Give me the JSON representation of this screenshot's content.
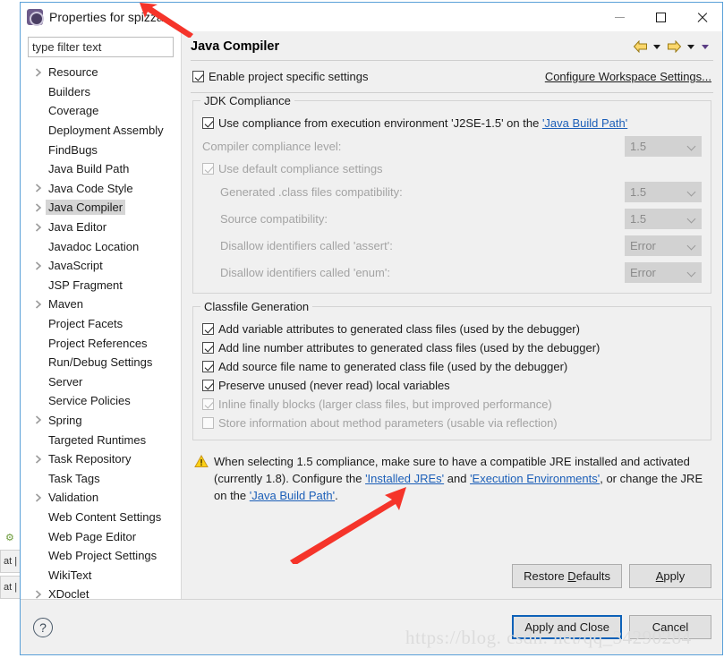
{
  "window": {
    "title": "Properties for spizza",
    "icon": "eclipse-properties-icon",
    "minimize_label": "Minimize",
    "maximize_label": "Maximize",
    "close_label": "Close"
  },
  "sidebar": {
    "filter_placeholder": "type filter text",
    "filter_value": "",
    "items": [
      {
        "label": "Resource",
        "expandable": true,
        "selected": false
      },
      {
        "label": "Builders",
        "expandable": false,
        "selected": false
      },
      {
        "label": "Coverage",
        "expandable": false,
        "selected": false
      },
      {
        "label": "Deployment Assembly",
        "expandable": false,
        "selected": false
      },
      {
        "label": "FindBugs",
        "expandable": false,
        "selected": false
      },
      {
        "label": "Java Build Path",
        "expandable": false,
        "selected": false
      },
      {
        "label": "Java Code Style",
        "expandable": true,
        "selected": false
      },
      {
        "label": "Java Compiler",
        "expandable": true,
        "selected": true
      },
      {
        "label": "Java Editor",
        "expandable": true,
        "selected": false
      },
      {
        "label": "Javadoc Location",
        "expandable": false,
        "selected": false
      },
      {
        "label": "JavaScript",
        "expandable": true,
        "selected": false
      },
      {
        "label": "JSP Fragment",
        "expandable": false,
        "selected": false
      },
      {
        "label": "Maven",
        "expandable": true,
        "selected": false
      },
      {
        "label": "Project Facets",
        "expandable": false,
        "selected": false
      },
      {
        "label": "Project References",
        "expandable": false,
        "selected": false
      },
      {
        "label": "Run/Debug Settings",
        "expandable": false,
        "selected": false
      },
      {
        "label": "Server",
        "expandable": false,
        "selected": false
      },
      {
        "label": "Service Policies",
        "expandable": false,
        "selected": false
      },
      {
        "label": "Spring",
        "expandable": true,
        "selected": false
      },
      {
        "label": "Targeted Runtimes",
        "expandable": false,
        "selected": false
      },
      {
        "label": "Task Repository",
        "expandable": true,
        "selected": false
      },
      {
        "label": "Task Tags",
        "expandable": false,
        "selected": false
      },
      {
        "label": "Validation",
        "expandable": true,
        "selected": false
      },
      {
        "label": "Web Content Settings",
        "expandable": false,
        "selected": false
      },
      {
        "label": "Web Page Editor",
        "expandable": false,
        "selected": false
      },
      {
        "label": "Web Project Settings",
        "expandable": false,
        "selected": false
      },
      {
        "label": "WikiText",
        "expandable": false,
        "selected": false
      },
      {
        "label": "XDoclet",
        "expandable": true,
        "selected": false
      }
    ]
  },
  "content": {
    "page_title": "Java Compiler",
    "nav": {
      "back_icon": "back-arrow-icon",
      "forward_icon": "forward-arrow-icon",
      "menu_icon": "view-menu-icon"
    },
    "enable_specific": {
      "label": "Enable project specific settings",
      "checked": true
    },
    "configure_workspace_link": "Configure Workspace Settings...",
    "jdk_compliance": {
      "title": "JDK Compliance",
      "use_execution_env": {
        "prefix": "Use compliance from execution environment 'J2SE-1.5' on the ",
        "link": "'Java Build Path'",
        "checked": true,
        "enabled": true
      },
      "compiler_compliance_level": {
        "label": "Compiler compliance level:",
        "value": "1.5",
        "enabled": false
      },
      "use_default_compliance": {
        "label": "Use default compliance settings",
        "checked": true,
        "enabled": false
      },
      "generated_class_compat": {
        "label": "Generated .class files compatibility:",
        "value": "1.5",
        "enabled": false
      },
      "source_compat": {
        "label": "Source compatibility:",
        "value": "1.5",
        "enabled": false
      },
      "disallow_assert": {
        "label": "Disallow identifiers called 'assert':",
        "value": "Error",
        "enabled": false
      },
      "disallow_enum": {
        "label": "Disallow identifiers called 'enum':",
        "value": "Error",
        "enabled": false
      }
    },
    "classfile_generation": {
      "title": "Classfile Generation",
      "options": [
        {
          "label": "Add variable attributes to generated class files (used by the debugger)",
          "checked": true,
          "enabled": true
        },
        {
          "label": "Add line number attributes to generated class files (used by the debugger)",
          "checked": true,
          "enabled": true
        },
        {
          "label": "Add source file name to generated class file (used by the debugger)",
          "checked": true,
          "enabled": true
        },
        {
          "label": "Preserve unused (never read) local variables",
          "checked": true,
          "enabled": true
        },
        {
          "label": "Inline finally blocks (larger class files, but improved performance)",
          "checked": true,
          "enabled": false
        },
        {
          "label": "Store information about method parameters (usable via reflection)",
          "checked": false,
          "enabled": false
        }
      ]
    },
    "warning": {
      "icon": "warning-triangle-icon",
      "part1": "When selecting 1.5 compliance, make sure to have a compatible JRE installed and activated (currently 1.8). Configure the ",
      "link1": "'Installed JREs'",
      "part2": " and ",
      "link2": "'Execution Environments'",
      "part3": ", or change the JRE on the ",
      "link3": "'Java Build Path'",
      "part4": "."
    },
    "restore_defaults_label": "Restore Defaults",
    "restore_defaults_mnemonic": "D",
    "apply_label": "Apply",
    "apply_mnemonic": "A"
  },
  "footer": {
    "help_icon": "question-mark-help-icon",
    "apply_and_close_label": "Apply and Close",
    "cancel_label": "Cancel",
    "watermark": "https://blog. csdn. net/qq_34290284"
  },
  "background": {
    "tabs": [
      "at |",
      "at |"
    ]
  },
  "colors": {
    "dialog_border": "#5aa0d8",
    "panel_bg": "#f0f0f0",
    "selection": "#d5d5d5",
    "link": "#1c5fb8",
    "default_button_border": "#0d61b8",
    "warning_icon": "#f0a30a",
    "annotation_arrow": "#f5342a"
  }
}
